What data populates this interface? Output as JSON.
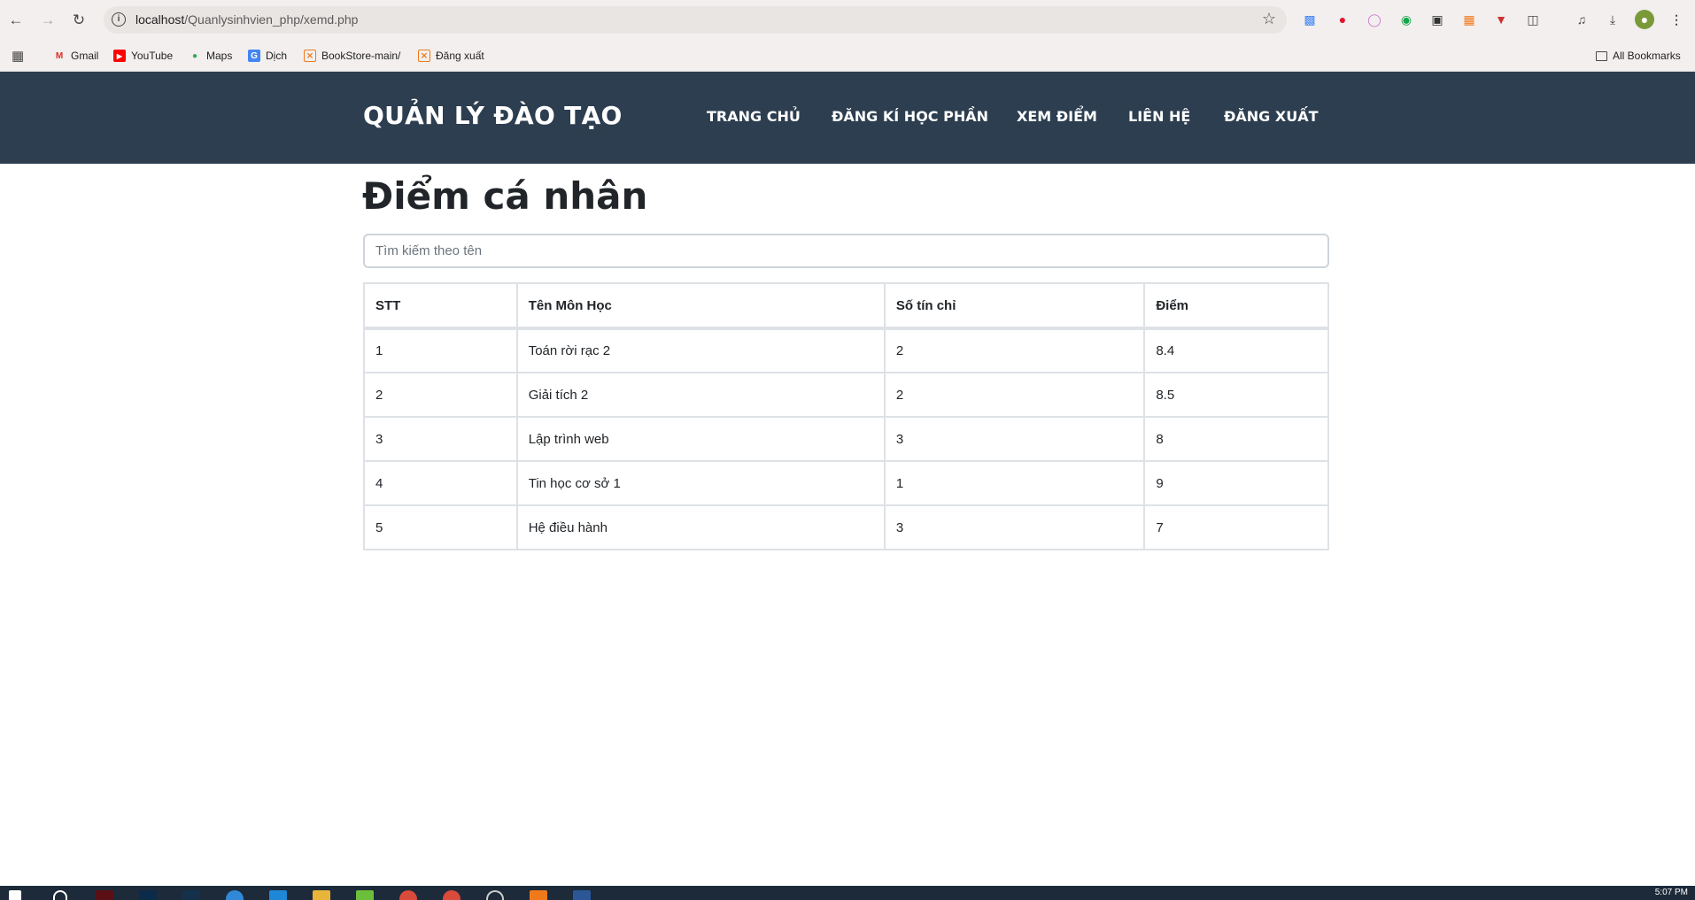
{
  "browser": {
    "url_host": "localhost",
    "url_path": "/Quanlysinhvien_php/xemd.php",
    "bookmarks": [
      {
        "label": "Gmail",
        "icon": "gmail-icon"
      },
      {
        "label": "YouTube",
        "icon": "youtube-icon"
      },
      {
        "label": "Maps",
        "icon": "maps-icon"
      },
      {
        "label": "Dịch",
        "icon": "translate-icon"
      },
      {
        "label": "BookStore-main/",
        "icon": "xampp-icon"
      },
      {
        "label": "Đăng xuất",
        "icon": "xampp-icon"
      }
    ],
    "all_bookmarks": "All Bookmarks"
  },
  "header": {
    "brand": "QUẢN LÝ ĐÀO TẠO",
    "nav": [
      "TRANG CHỦ",
      "ĐĂNG KÍ HỌC PHẦN",
      "XEM ĐIỂM",
      "LIÊN HỆ",
      "ĐĂNG XUẤT"
    ]
  },
  "main": {
    "title": "Điểm cá nhân",
    "search_placeholder": "Tìm kiếm theo tên",
    "table": {
      "headers": [
        "STT",
        "Tên Môn Học",
        "Số tín chỉ",
        "Điểm"
      ],
      "rows": [
        [
          "1",
          "Toán rời rạc 2",
          "2",
          "8.4"
        ],
        [
          "2",
          "Giải tích 2",
          "2",
          "8.5"
        ],
        [
          "3",
          "Lập trình web",
          "3",
          "8"
        ],
        [
          "4",
          "Tin học cơ sở 1",
          "1",
          "9"
        ],
        [
          "5",
          "Hệ điều hành",
          "3",
          "7"
        ]
      ]
    }
  },
  "taskbar": {
    "clock": "5:07 PM"
  },
  "colors": {
    "header_bg": "#2c3e50",
    "text": "#212529",
    "border": "#dee2e6"
  }
}
